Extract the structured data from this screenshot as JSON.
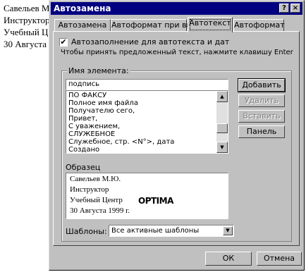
{
  "document": {
    "lines": [
      "Савельев М",
      "Инструктор",
      "Учебный Це",
      "30 Августа"
    ]
  },
  "dialog": {
    "title": "Автозамена",
    "help_btn": "?",
    "close_btn": "×",
    "tabs": [
      {
        "label": "Автозамена",
        "active": false
      },
      {
        "label": "Автоформат при вводе",
        "active": false
      },
      {
        "label": "Автотекст",
        "active": true
      },
      {
        "label": "Автоформат",
        "active": false
      }
    ],
    "autocomplete": {
      "checked": true,
      "check_mark": "✔",
      "label": "Автозаполнение для автотекста и дат",
      "hint": "Чтобы принять предложенный текст, нажмите клавишу Enter"
    },
    "element_name": {
      "caption": "Имя элемента:",
      "value": "подпись",
      "list": [
        "ПО ФАКСУ",
        "Полное имя файла",
        "Получателю сего,",
        "Привет,",
        "С уважением,",
        "СЛУЖЕБНОЕ",
        "Служебное, стр. <N°>, дата",
        "Создано"
      ]
    },
    "buttons": {
      "add": "Добавить",
      "delete": "Удалить",
      "insert": "Вставить",
      "toolbar": "Панель",
      "ok": "ОК",
      "cancel": "Отмена"
    },
    "sample": {
      "caption": "Образец",
      "lines": [
        "Савельев М.Ю.",
        "Инструктор",
        "Учебный Центр",
        "30 Августа 1999 г."
      ],
      "logo": "OPTIMA"
    },
    "templates": {
      "label": "Шаблоны:",
      "value": "Все активные шаблоны"
    }
  }
}
